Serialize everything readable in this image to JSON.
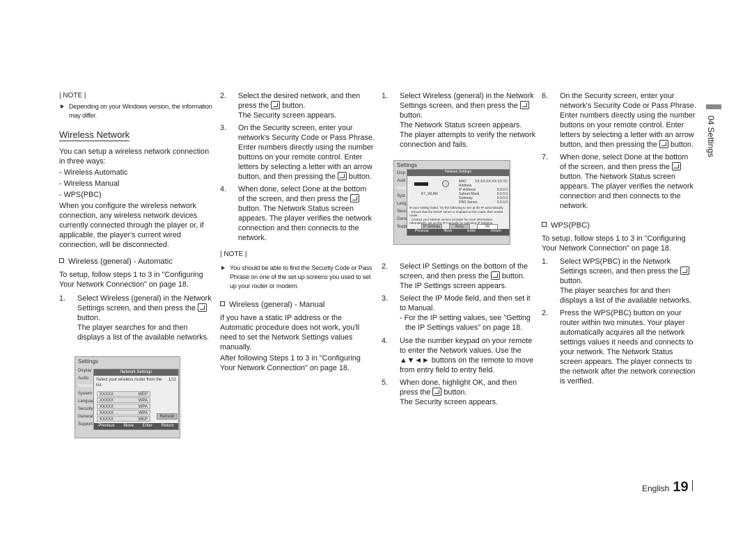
{
  "col1": {
    "note_label": "| NOTE |",
    "note": "Depending on your Windows version, the information may differ.",
    "heading": "Wireless Network",
    "intro": "You can setup a wireless network connection in three ways:",
    "ways": [
      "- Wireless Automatic",
      "- Wireless Manual",
      "- WPS(PBC)"
    ],
    "warning": "When you configure the wireless network connection, any wireless network devices currently connected through the player or, if applicable, the player's current wired connection, will be disconnected.",
    "subheading": "Wireless (general) - Automatic",
    "setup": "To setup, follow steps 1 to 3 in \"Configuring Your Network Connection\" on page 18.",
    "step1": {
      "n": "1.",
      "a": "Select Wireless (general) in the Network Settings screen, and then press the",
      "b": "button.",
      "c": "The player searches for and then displays a list of the available networks."
    }
  },
  "inset1": {
    "title": "Settings",
    "menu": [
      "Display",
      "Audio",
      "Network",
      "System",
      "Language",
      "Security",
      "General",
      "Support"
    ],
    "dialog_title": "Network Settings",
    "prompt": "Select your wireless router from the list.",
    "page": "1/11",
    "rows": [
      [
        "XXXXX",
        "WEP"
      ],
      [
        "XXXXX",
        "WPA"
      ],
      [
        "XXXXX",
        "WPA"
      ],
      [
        "XXXXX",
        "WPA"
      ],
      [
        "XXXXX",
        "WEP"
      ]
    ],
    "refresh": "Refresh",
    "footer": [
      "Previous",
      "Move",
      "Enter",
      "Return"
    ]
  },
  "col2": {
    "step2": {
      "n": "2.",
      "a": "Select the desired network, and then press the",
      "b": "button.",
      "c": "The Security screen appears."
    },
    "step3": {
      "n": "3.",
      "a": "On the Security screen, enter your network's Security Code or Pass Phrase.",
      "b": "Enter numbers directly using the number buttons on your remote control. Enter letters by selecting a letter with an arrow button, and then pressing the",
      "c": "button."
    },
    "step4": {
      "n": "4.",
      "a": "When done, select Done at the bottom of the screen, and then press the",
      "b": "button. The Network Status screen appears. The player verifies the network connection and then connects to the network."
    },
    "note_label": "| NOTE |",
    "note": "You should be able to find the Security Code or Pass Phrase on one of the set up screens you used to set up your router or modem.",
    "subheading": "Wireless (general) - Manual",
    "p1": "If you have a static IP address or the Automatic procedure does not work, you'll need to set the Network Settings values manually.",
    "p2": "After following Steps 1 to 3 in \"Configuring Your Network Connection\" on page 18."
  },
  "inset2": {
    "title": "Settings",
    "menu": [
      "Disp",
      "Audi",
      "Netw",
      "Syst",
      "Lang",
      "Secu",
      "Gene",
      "Supp"
    ],
    "dialog_title": "Network Settings",
    "ssid": "KT_WLAN",
    "fields": [
      [
        "MAC Address",
        "XX:XX:XX:XX:XX:XX"
      ],
      [
        "IP Address",
        "0.0.0.0"
      ],
      [
        "Subnet Mask",
        "0.0.0.0"
      ],
      [
        "Gateway",
        "0.0.0.0"
      ],
      [
        "DNS Server",
        "0.0.0.0"
      ]
    ],
    "message": [
      "IP auto setting failed. Try the following to set up the IP automatically.",
      "- Ensure that the DHCP server is enabled on the router, then restart router.",
      "- Contact your internet service provider for more information.",
      "Alternatively, set up the IP manually by selecting IP Settings."
    ],
    "buttons": [
      "IP Settings",
      "Retry",
      "OK"
    ],
    "footer": [
      "Previous",
      "Move",
      "Enter",
      "Return"
    ]
  },
  "col3": {
    "step1": {
      "n": "1.",
      "a": "Select Wireless (general) in the Network Settings screen, and then press the",
      "b": "button.",
      "c": "The Network Status screen appears. The player attempts to verify the network connection and fails."
    },
    "step2": {
      "n": "2.",
      "a": "Select IP Settings on the bottom of the screen, and then press the",
      "b": "button. The IP Settings screen appears."
    },
    "step3": {
      "n": "3.",
      "a": "Select the IP Mode field, and then set it to Manual.",
      "b": "- For the IP setting values, see \"Getting the IP Settings values\" on page 18."
    },
    "step4": {
      "n": "4.",
      "a": "Use the number keypad on your remote to enter the Network values. Use the ▲▼◄► buttons on the remote to move from entry field to entry field."
    },
    "step5": {
      "n": "5.",
      "a": "When done, highlight OK, and then press the",
      "b": "button.",
      "c": "The Security screen appears."
    }
  },
  "col4": {
    "step6": {
      "n": "6.",
      "a": "On the Security screen, enter your network's Security Code or Pass Phrase.",
      "b": "Enter numbers directly using the number buttons on your remote control. Enter letters by selecting a letter with an arrow button, and then pressing the",
      "c": "button."
    },
    "step7": {
      "n": "7.",
      "a": "When done, select Done at the bottom of the screen, and then press the",
      "b": "button. The Network Status screen appears. The player verifies the network connection and then connects to the network."
    },
    "subheading": "WPS(PBC)",
    "setup": "To setup, follow steps 1 to 3 in \"Configuring Your Network Connection\" on page 18.",
    "step1": {
      "n": "1.",
      "a": "Select WPS(PBC) in the Network Settings screen, and then press the",
      "b": "button.",
      "c": "The player searches for and then displays a list of the available networks."
    },
    "step2": {
      "n": "2.",
      "a": "Press the WPS(PBC) button on your router within two minutes. Your player automatically acquires all the network settings values it needs and connects to your network. The Network Status screen appears. The player connects to the network after the network connection is verified."
    }
  },
  "side_tab": "04  Settings",
  "footer": {
    "language": "English",
    "page": "19"
  }
}
